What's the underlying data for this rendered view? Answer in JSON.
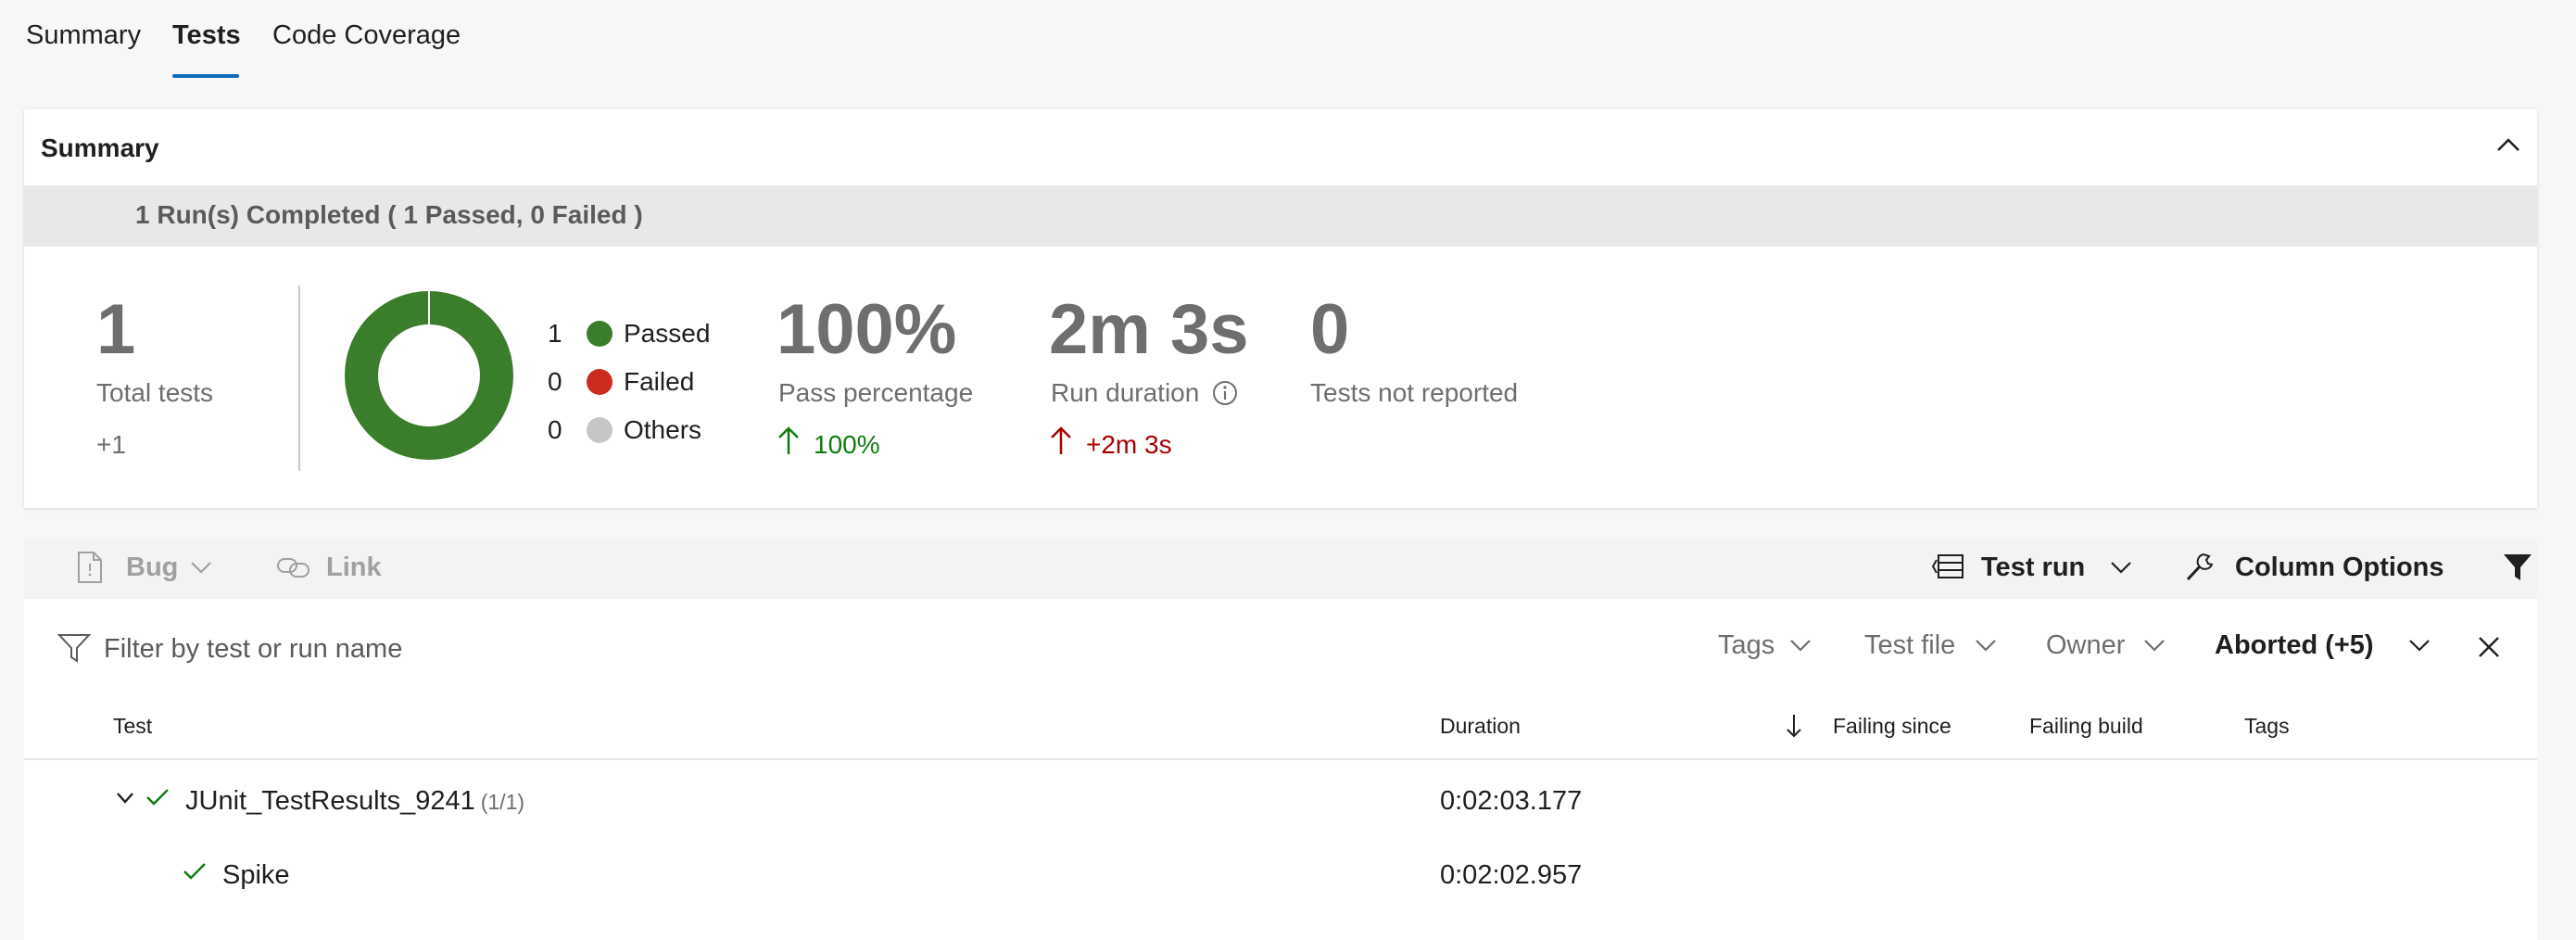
{
  "tabs": [
    {
      "label": "Summary"
    },
    {
      "label": "Tests"
    },
    {
      "label": "Code Coverage"
    }
  ],
  "summary": {
    "title": "Summary",
    "run_banner": "1 Run(s) Completed ( 1 Passed, 0 Failed )",
    "total_tests": {
      "value": "1",
      "label": "Total tests",
      "delta": "+1"
    },
    "outcome_chart": {
      "legend": [
        {
          "count": "1",
          "label": "Passed",
          "color": "#3a7d2b"
        },
        {
          "count": "0",
          "label": "Failed",
          "color": "#cc2b1f"
        },
        {
          "count": "0",
          "label": "Others",
          "color": "#c6c6c6"
        }
      ]
    },
    "pass_percentage": {
      "value": "100%",
      "label": "Pass percentage",
      "delta": "100%"
    },
    "run_duration": {
      "value": "2m 3s",
      "label": "Run duration",
      "delta": "+2m 3s"
    },
    "not_reported": {
      "value": "0",
      "label": "Tests not reported"
    }
  },
  "chart_data": {
    "type": "pie",
    "categories": [
      "Passed",
      "Failed",
      "Others"
    ],
    "values": [
      1,
      0,
      0
    ],
    "colors": [
      "#3a7d2b",
      "#cc2b1f",
      "#c6c6c6"
    ]
  },
  "toolbar": {
    "bug_label": "Bug",
    "link_label": "Link",
    "group_by_label": "Test run",
    "column_options_label": "Column Options"
  },
  "filter": {
    "placeholder": "Filter by test or run name",
    "pills": {
      "tags": "Tags",
      "test_file": "Test file",
      "owner": "Owner",
      "outcome": "Aborted (+5)"
    }
  },
  "table": {
    "headers": {
      "test": "Test",
      "duration": "Duration",
      "failing_since": "Failing since",
      "failing_build": "Failing build",
      "tags": "Tags"
    },
    "group_row": {
      "name": "JUnit_TestResults_9241",
      "count": "(1/1)",
      "duration": "0:02:03.177"
    },
    "test_row": {
      "name": "Spike",
      "duration": "0:02:02.957"
    }
  },
  "colors": {
    "accent": "#0f6cbd",
    "pass": "#107c10",
    "fail": "#a80000"
  }
}
